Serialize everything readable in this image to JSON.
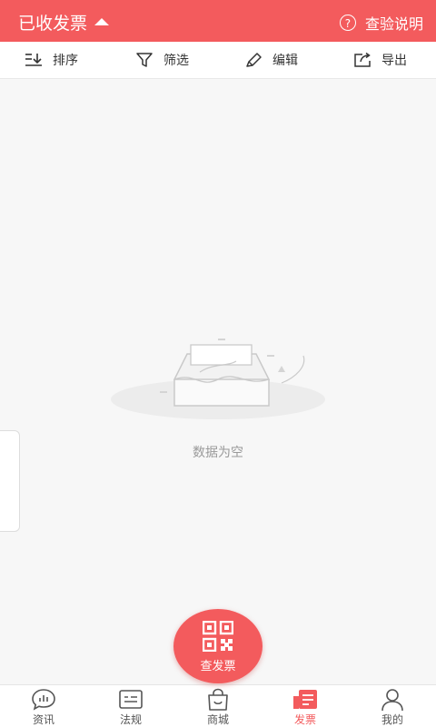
{
  "header": {
    "title": "已收发票",
    "help_label": "查验说明",
    "help_icon": "question-icon"
  },
  "toolbar": {
    "sort": {
      "label": "排序",
      "icon": "sort-icon"
    },
    "filter": {
      "label": "筛选",
      "icon": "filter-icon"
    },
    "edit": {
      "label": "编辑",
      "icon": "pencil-icon"
    },
    "export": {
      "label": "导出",
      "icon": "export-icon"
    }
  },
  "empty_state": {
    "message": "数据为空",
    "icon": "empty-box-icon"
  },
  "fab": {
    "label": "查发票",
    "icon": "qr-code-icon"
  },
  "tabbar": {
    "items": [
      {
        "label": "资讯",
        "icon": "chat-chart-icon"
      },
      {
        "label": "法规",
        "icon": "document-icon"
      },
      {
        "label": "商城",
        "icon": "shopping-bag-icon"
      },
      {
        "label": "发票",
        "icon": "invoice-icon"
      },
      {
        "label": "我的",
        "icon": "user-icon"
      }
    ],
    "active_index": 3
  },
  "colors": {
    "accent": "#f35b5d",
    "background": "#f7f7f7",
    "muted_text": "#9a9a9a"
  }
}
